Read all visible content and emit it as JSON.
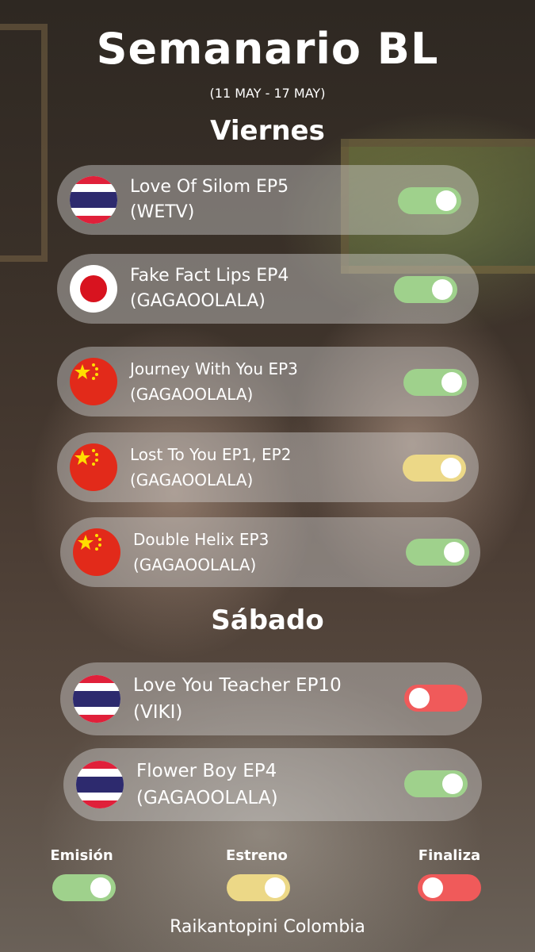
{
  "header": {
    "title": "Semanario BL",
    "dates": "(11 MAY - 17 MAY)"
  },
  "days": [
    {
      "name": "Viernes",
      "shows": [
        {
          "title": "Love Of Silom EP5",
          "platform": "(WETV)",
          "flag": "thailand-flag-icon",
          "status": "emision"
        },
        {
          "title": "Fake Fact Lips EP4",
          "platform": "(GAGAOOLALA)",
          "flag": "japan-flag-icon",
          "status": "emision"
        },
        {
          "title": "Journey With You EP3",
          "platform": "(GAGAOOLALA)",
          "flag": "china-flag-icon",
          "status": "emision"
        },
        {
          "title": "Lost To You EP1, EP2",
          "platform": "(GAGAOOLALA)",
          "flag": "china-flag-icon",
          "status": "estreno"
        },
        {
          "title": "Double Helix EP3",
          "platform": "(GAGAOOLALA)",
          "flag": "china-flag-icon",
          "status": "emision"
        }
      ]
    },
    {
      "name": "Sábado",
      "shows": [
        {
          "title": "Love You Teacher EP10",
          "platform": "(VIKI)",
          "flag": "thailand-flag-icon",
          "status": "finaliza"
        },
        {
          "title": "Flower Boy EP4",
          "platform": "(GAGAOOLALA)",
          "flag": "thailand-flag-icon",
          "status": "emision"
        }
      ]
    }
  ],
  "legend": {
    "emision": "Emisión",
    "estreno": "Estreno",
    "finaliza": "Finaliza"
  },
  "colors": {
    "emision": "#9fd18c",
    "estreno": "#ecd887",
    "finaliza": "#f05a5a"
  },
  "footer": "Raikantopini Colombia"
}
